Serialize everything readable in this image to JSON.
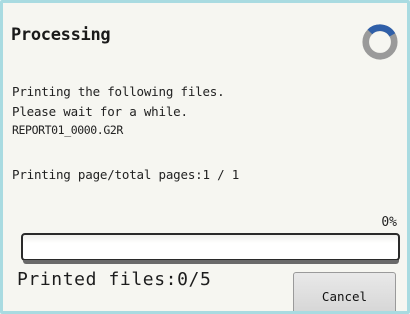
{
  "dialog": {
    "title": "Processing",
    "icon": "busy-spinner-icon",
    "message_line1": "Printing the following files.",
    "message_line2": "Please wait for a while.",
    "file_name": "REPORT01_0000.G2R",
    "page_status": "Printing page/total pages:1 / 1",
    "progress_percent_label": "0%",
    "progress_value": 0,
    "printed_files": "Printed files:0/5",
    "cancel_label": "Cancel"
  },
  "colors": {
    "border": "#a9dbe1",
    "background": "#f6f6f1",
    "spinner_gray": "#9a9a9a",
    "spinner_blue": "#2f5fa8"
  }
}
